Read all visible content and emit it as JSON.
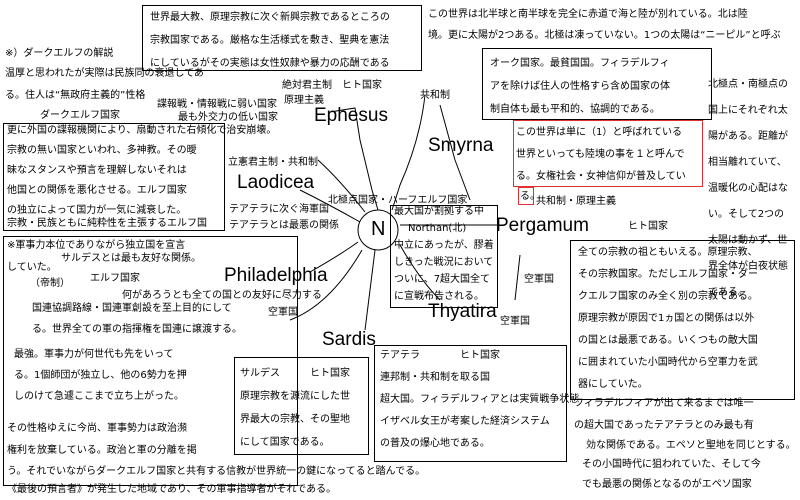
{
  "cities": {
    "ephesus": "Ephesus",
    "smyrna": "Smyrna",
    "laodicea": "Laodicea",
    "pergamum": "Pergamum",
    "philadelphia": "Philadelphia",
    "thyatira": "Thyatira",
    "sardis": "Sardis",
    "center": "N"
  },
  "labels": {
    "darkelf_note": "※）ダークエルフの解説",
    "darkelf_head": "ダークエルフ国家",
    "ephesus_tags1": "絶対君主制　ヒト国家",
    "ephesus_tags2": "原理主義",
    "ephesus_kyowa": "共和制",
    "ephesus_tags3": "諜報戦・情報戦に弱い国家",
    "ephesus_tags4": "最も外交力の低い国家",
    "laodicea_tags": "立憲君主制・共和制",
    "north_tags": "北極点国家・ハーフエルフ国家",
    "laodicea_note": "テアテラに次ぐ海軍国",
    "laodicea_note2": "テアテラとは最悪の関係",
    "pergamum_tags": "共和制・原理主義",
    "pergamum_human": "ヒト国家",
    "navy1": "空軍国",
    "navy2": "空軍国",
    "sardis_friendly": "サルデスとは最も友好な関係。",
    "elf_nation": "エルフ国家",
    "empire": "（帝制）",
    "phila_note": "何があろうとも全ての国との友好に尽力する",
    "phila_navy": "空軍国"
  },
  "top_box": [
    "世界最大教、原理宗教に次ぐ新興宗教であるところの",
    "宗教国家である。厳格な生活様式を敷き、聖典を憲法",
    "にしているがその実態は女性奴隷や暴力の応酬である"
  ],
  "world_intro": [
    "この世界は北半球と南半球を完全に赤道で海と陸が別れている。北は陸",
    "境。更に太陽が2つある。北極は凍っていない。1つの太陽は“ニーピル”と呼ぶ"
  ],
  "smyrna_box": [
    "オーク国家。最貧国国。フィラデルフィ",
    "アを除けば住人の性格すら含め国家の体",
    "制自体も最も平和的、協調的である。"
  ],
  "red_box": [
    "この世界は単に（1）と呼ばれている",
    "世界といっても陸塊の事を１と呼んで",
    "る。女権社会・女神信仰が普及してい",
    "る。"
  ],
  "right_col": [
    "北極点・南極点の",
    "国上にそれぞれ太",
    "陽がある。距離が",
    "相当離れていて、",
    "温暖化の心配はな",
    "い。そして2つの",
    "太陽は動かず、世",
    "界全体が白夜状態",
    "である。"
  ],
  "darkelf_top": [
    "温厚と思われたが実際は民族同の衰退してあ",
    "る。住人は“無政府主義的”性格"
  ],
  "darkelf_box": [
    "更に外国の諜報機関により、扇動された右傾化で治安崩壊。",
    "宗教の無い国家といわれ、多神教。その曖",
    "昧なスタンスや預言を理解しないそれは",
    "他国との関係を悪化させる。エルフ国家",
    "の独立によって国力が一気に減衰した。",
    "宗教・民族ともに純粋性を主張するエルフ国"
  ],
  "center_box": [
    "最大国が割拠する中",
    "Northan(北)",
    "中立にあったが、膠着",
    "しきった戦況において",
    "ついに、7超大国全て",
    "に宣戦布告される。"
  ],
  "military_box": [
    "※軍事力本位でありながら独立国を宣言",
    "していた。",
    "国連協調路線・国連軍創設を至上目的にして",
    "る。世界全ての軍の指揮権を国連に譲渡する。",
    "最強。軍事力が何世代も先をいって",
    "る。1個師団が独立し、他の6勢力を押",
    "しのけて急遽ここまで立ち上がった。",
    "その性格ゆえに今尚、軍事勢力は政治瀕",
    "権利を放棄している。政治と軍の分離を掲",
    "う。それでいながらダークエルフ国家と共有する信教が世界統一の鍵になってると踏んでる。",
    "《最後の預言者》が発生した地域であり、その軍事指導者がそれである。"
  ],
  "sardis_box": [
    "サルデス　　　ヒト国家",
    "原理宗教を源流にした世",
    "界最大の宗教、その聖地",
    "にして国家である。"
  ],
  "thyatira_box": [
    "テアテラ　　　　ヒト国家",
    "連邦制・共和制を取る国",
    "超大国。フィラデルフィアとは実質戦争状態",
    "イザベル女王が考案した経済システム",
    "の普及の爆心地である。"
  ],
  "pergamum_box": [
    "全ての宗教の祖ともいえる。原理宗教、",
    "その宗教国家。ただしエルフ国家・ダー",
    "クエルフ国家のみ全く別の宗教である。",
    "原理宗教が原因で1ヵ国との関係は以外",
    "の国とは最悪である。いくつもの敵大国",
    "に囲まれていた小国時代から空軍力を武",
    "器にしていた。"
  ],
  "bottom_right": [
    "フィラデルフィアが出て来るまでは唯一",
    "の超大国であったテアテラとのみ最も有",
    "効な関係である。エペソと聖地を同じとする。",
    "その小国時代に狙われていた、そして今",
    "でも最悪の関係となるのがエペソ国家"
  ]
}
